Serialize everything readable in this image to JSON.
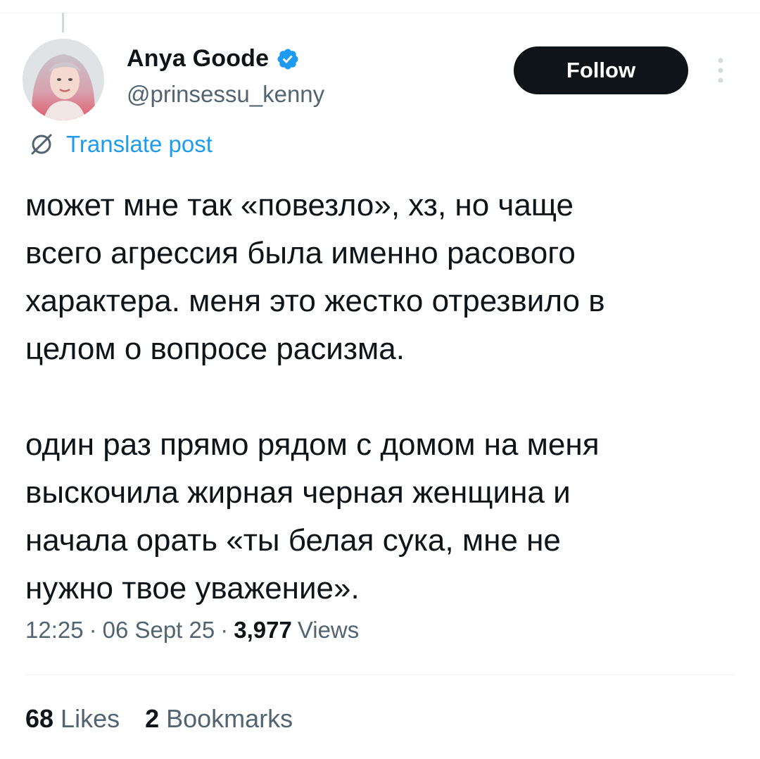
{
  "author": {
    "display_name": "Anya Goode",
    "handle": "@prinsessu_kenny",
    "verified": true
  },
  "actions": {
    "follow_label": "Follow",
    "more_icon": "more-vertical-icon"
  },
  "translate": {
    "label": "Translate post",
    "icon": "translate-icon"
  },
  "post": {
    "paragraphs": [
      "может мне так «повезло», хз, но чаще\nвсего агрессия была именно расового\nхарактера. меня это жестко отрезвило в\nцелом о вопросе расизма.",
      "один раз прямо рядом с домом на меня\nвыскочила жирная черная женщина и\nначала орать «ты белая сука, мне не\nнужно твое уважение»."
    ]
  },
  "meta": {
    "time": "12:25",
    "separator": "·",
    "date": "06 Sept 25",
    "views_count": "3,977",
    "views_label": "Views"
  },
  "stats": {
    "likes_count": "68",
    "likes_label": "Likes",
    "bookmarks_count": "2",
    "bookmarks_label": "Bookmarks"
  },
  "colors": {
    "accent": "#1d9bf0",
    "text_primary": "#0f1419",
    "text_secondary": "#536471",
    "button_bg": "#0f1419"
  }
}
